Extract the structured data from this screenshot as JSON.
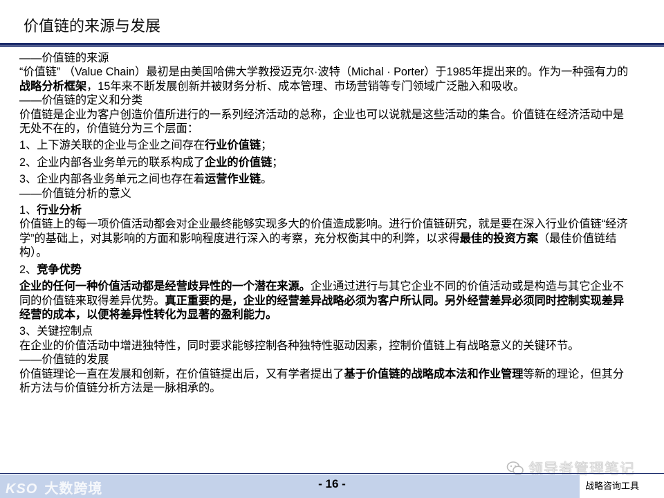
{
  "title": "价值链的来源与发展",
  "content": {
    "s1_head": "——价值链的来源",
    "p1_a": "“价值链” （Value Chain）最初是由美国哈佛大学教授迈克尔·波特（Michal · Porter）于1985年提出来的。作为一种强有力的",
    "p1_b": "战略分析框架",
    "p1_c": "，15年来不断发展创新并被财务分析、成本管理、市场营销等专门领域广泛融入和吸收。",
    "s2_head": "——价值链的定义和分类",
    "p2": "价值链是企业为客户创造价值所进行的一系列经济活动的总称，企业也可以说就是这些活动的集合。价值链在经济活动中是无处不在的，价值链分为三个层面：",
    "item1_a": "1、上下游关联的企业与企业之间存在",
    "item1_b": "行业价值链",
    "item1_c": "；",
    "item2_a": "2、企业内部各业务单元的联系构成了",
    "item2_b": "企业的价值链",
    "item2_c": "；",
    "item3_a": "3、企业内部各业务单元之间也存在着",
    "item3_b": "运营作业链",
    "item3_c": "。",
    "s3_head": "——价值链分析的意义",
    "sub1_a": "1、",
    "sub1_b": "行业分析",
    "p3_a": "价值链上的每一项价值活动都会对企业最终能够实现多大的价值造成影响。进行价值链研究，就是要在深入行业价值链“经济学”的基础上，对其影响的方面和影响程度进行深入的考察，充分权衡其中的利弊，以求得",
    "p3_b": "最佳的投资方案",
    "p3_c": "（最佳价值链结构）。",
    "sub2_a": "2、",
    "sub2_b": "竞争优势",
    "p4_a": "企业的任何一种价值活动都是经营歧异性的一个潜在来源。",
    "p4_b": "企业通过进行与其它企业不同的价值活动或是构造与其它企业不同的价值链来取得差异优势。",
    "p4_c": "真正重要的是，企业的经营差异战略必须为客户所认同。另外经营差异必须同时控制实现差异经营的成本，以便将差异性转化为显著的盈利能力。",
    "sub3": "3、关键控制点",
    "p5": "在企业的价值活动中增进独特性，同时要求能够控制各种独特性驱动因素，控制价值链上有战略意义的关键环节。",
    "s4_head": "——价值链的发展",
    "p6_a": "价值链理论一直在发展和创新，在价值链提出后，又有学者提出了",
    "p6_b": "基于价值链的战略成本法和作业管理",
    "p6_c": "等新的理论，但其分析方法与价值链分析方法是一脉相承的。"
  },
  "footer": {
    "page": "- 16 -",
    "right_text": "战略咨询工具",
    "watermark_left_mark": "KSO",
    "watermark_left_text": "大数跨境",
    "watermark_right_text": "领导者管理笔记"
  }
}
